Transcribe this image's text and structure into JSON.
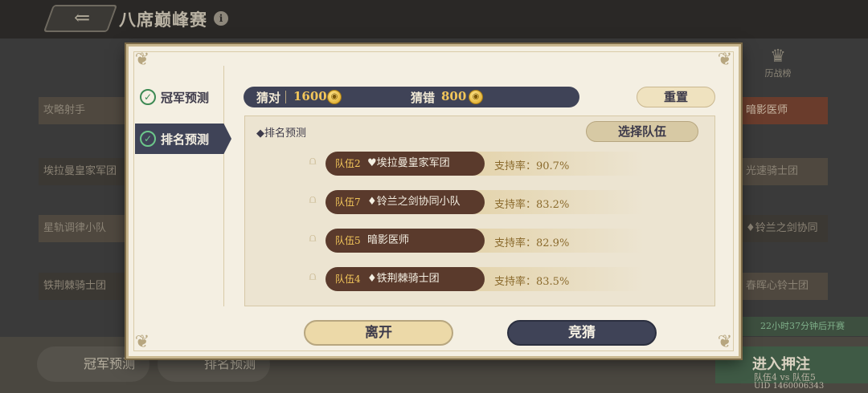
{
  "background": {
    "title": "八席巅峰赛",
    "left_slots": [
      "攻略射手",
      "埃拉曼皇家军团",
      "星轨调律小队",
      "铁荆棘骑士团"
    ],
    "right_slots": [
      "暗影医师",
      "光速骑士团",
      "♦铃兰之剑协同",
      "春晖心铃士团"
    ],
    "history_label": "历战榜",
    "timer": "22小时37分钟后开赛",
    "bottom_tabs": [
      "冠军预测",
      "排名预测"
    ],
    "enter_title": "进入押注",
    "enter_sub": "队伍4 vs 队伍5",
    "uid": "UID 1460006343"
  },
  "dialog": {
    "side_tabs": [
      {
        "label": "冠军预测",
        "active": false
      },
      {
        "label": "排名预测",
        "active": true
      }
    ],
    "score": {
      "correct_label": "猜对",
      "correct_value": "1600",
      "wrong_label": "猜错",
      "wrong_value": "800"
    },
    "reset_label": "重置",
    "rank_title": "◆排名预测",
    "select_team_label": "选择队伍",
    "rankings": [
      {
        "team_id": "队伍2",
        "team_name": "♥埃拉曼皇家军团",
        "support": "支持率：90.7%"
      },
      {
        "team_id": "队伍7",
        "team_name": "♦铃兰之剑协同小队",
        "support": "支持率：83.2%"
      },
      {
        "team_id": "队伍5",
        "team_name": "暗影医师",
        "support": "支持率：82.9%"
      },
      {
        "team_id": "队伍4",
        "team_name": "♦铁荆棘骑士团",
        "support": "支持率：83.5%"
      }
    ],
    "leave_label": "离开",
    "guess_label": "竞猜"
  },
  "icons": {
    "back": "back-arrow-icon",
    "info": "info-icon",
    "check": "check-icon",
    "coin": "coin-icon",
    "rank": "podium-icon"
  }
}
